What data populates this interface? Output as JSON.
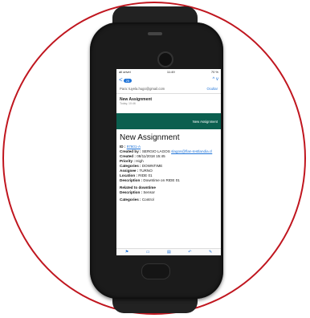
{
  "status": {
    "carrier": "all orivei",
    "time": "11:49",
    "battery": "70 %"
  },
  "nav": {
    "back_glyph": "<",
    "badge": "25",
    "up": "^",
    "down": "v"
  },
  "header": {
    "to_label": "Para:",
    "to_value": "tuyela.hugo@gmail.com",
    "hide": "Ocultar"
  },
  "email": {
    "subject": "New Assignment",
    "date": "Today, 10:46"
  },
  "banner": {
    "label": "New Assignment"
  },
  "content": {
    "title": "New Assignment",
    "id_label": "ID :",
    "id_value": "97601-A",
    "created_by_label": "Created by :",
    "created_by_value": "SERGIO LAGOS",
    "created_by_email": "slagos@flan-testlandia.cl",
    "created_label": "Created :",
    "created_value": "08/11/2018 15:45",
    "priority_label": "Priority :",
    "priority_value": "High",
    "categories_label": "Categories :",
    "categories_value": "DOWNTIME",
    "assignee_label": "Assignee :",
    "assignee_value": "TURNO",
    "location_label": "Location :",
    "location_value": "RIDE 01",
    "description_label": "Description :",
    "description_value": "Downtime on RIDE 01",
    "related_label": "Related to downtime",
    "description2_label": "Description :",
    "description2_value": "Sensor",
    "categories2_label": "Categories :",
    "categories2_value": "Control"
  },
  "toolbar": {
    "icons": [
      "flag-icon",
      "folder-icon",
      "archive-icon",
      "reply-icon",
      "compose-icon"
    ]
  }
}
